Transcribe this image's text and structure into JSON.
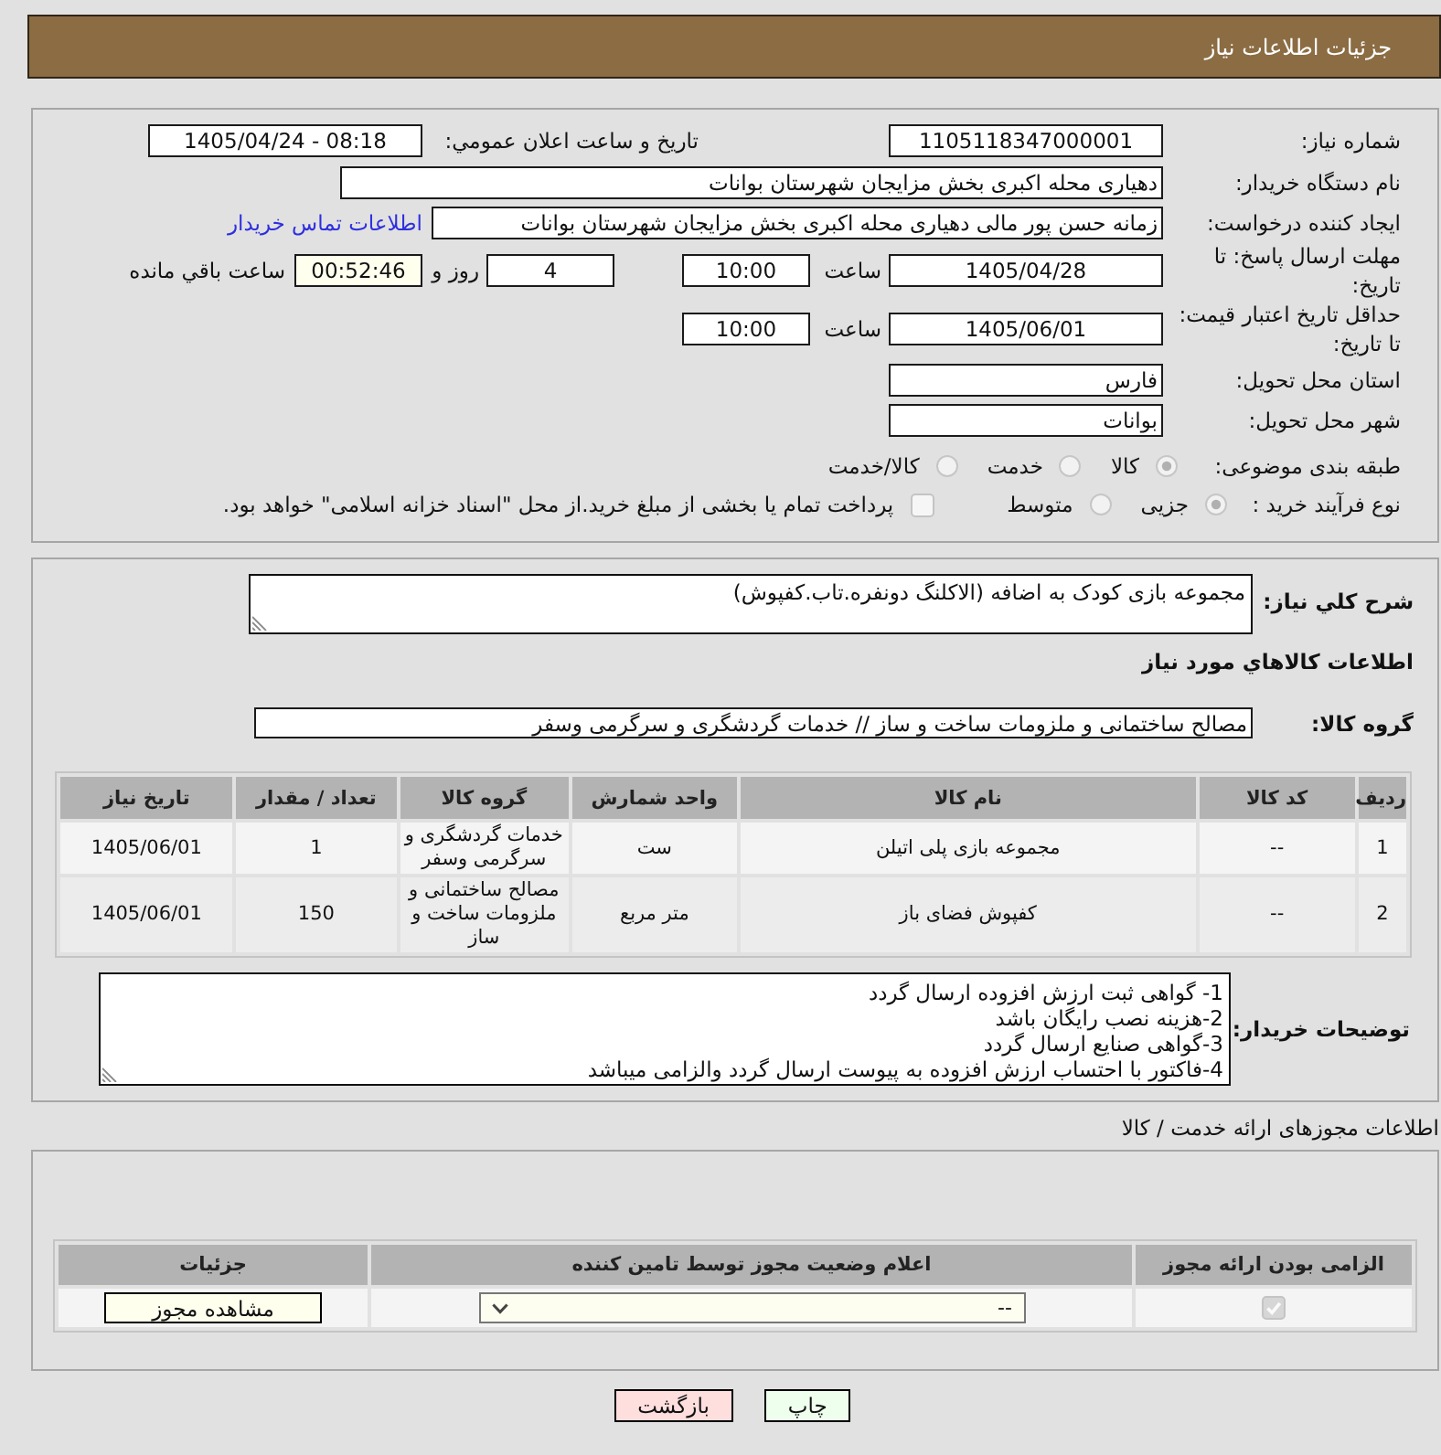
{
  "header": {
    "title": "جزئیات اطلاعات نیاز"
  },
  "summary": {
    "need_number": {
      "label": "شماره نیاز:",
      "value": "1105118347000001"
    },
    "announcement": {
      "label": "تاریخ و ساعت اعلان عمومي:",
      "value": "1405/04/24 - 08:18"
    },
    "buyer": {
      "label": "نام دستگاه خریدار:",
      "value": "دهیاری محله اکبری بخش مزایجان شهرستان بوانات"
    },
    "requester": {
      "label": "ایجاد کننده درخواست:",
      "value": "زمانه حسن پور مالی دهیاری محله اکبری بخش مزایجان شهرستان بوانات",
      "contact_link": "اطلاعات تماس خریدار"
    },
    "reply_deadline": {
      "label": "مهلت ارسال پاسخ: تا تاریخ:",
      "date": "1405/04/28",
      "time_label": "ساعت",
      "time": "10:00",
      "days": "4",
      "days_label": "روز و",
      "remaining": "00:52:46",
      "remaining_label": "ساعت باقي مانده"
    },
    "price_validity": {
      "label": "حداقل تاریخ اعتبار قیمت: تا تاریخ:",
      "date": "1405/06/01",
      "time_label": "ساعت",
      "time": "10:00"
    },
    "province": {
      "label": "استان محل تحویل:",
      "value": "فارس"
    },
    "city": {
      "label": "شهر محل تحویل:",
      "value": "بوانات"
    },
    "category": {
      "label": "طبقه بندی موضوعی:",
      "options": [
        {
          "label": "کالا",
          "selected": true
        },
        {
          "label": "خدمت",
          "selected": false
        },
        {
          "label": "کالا/خدمت",
          "selected": false
        }
      ]
    },
    "purchase_process": {
      "label": "نوع فرآیند خرید :",
      "options": [
        {
          "label": "جزیی",
          "selected": true
        },
        {
          "label": "متوسط",
          "selected": false
        }
      ],
      "treasury_payment": {
        "label": "پرداخت تمام یا بخشی از مبلغ خرید.از محل \"اسناد خزانه اسلامی\" خواهد بود.",
        "checked": false
      }
    }
  },
  "items": {
    "description_label": "شرح کلي نیاز:",
    "description": "مجموعه بازی کودک به اضافه (الاکلنگ دونفره.تاب.کفپوش)",
    "section_title": "اطلاعات کالاهاي مورد نیاز",
    "group_label": "گروه کالا:",
    "group_value": "مصالح ساختمانی و ملزومات ساخت و ساز // خدمات گردشگری و سرگرمی وسفر",
    "table": {
      "columns": [
        "ردیف",
        "کد کالا",
        "نام کالا",
        "واحد شمارش",
        "گروه کالا",
        "تعداد / مقدار",
        "تاریخ نیاز"
      ],
      "rows": [
        [
          "1",
          "--",
          "مجموعه بازی پلی اتیلن",
          "ست",
          "خدمات گردشگری و سرگرمی وسفر",
          "1",
          "1405/06/01"
        ],
        [
          "2",
          "--",
          "کفپوش فضای باز",
          "متر مربع",
          "مصالح ساختمانی و ملزومات ساخت و ساز",
          "150",
          "1405/06/01"
        ]
      ]
    },
    "notes_label": "توضیحات خریدار:",
    "notes": [
      "1- گواهی ثبت ارزش افزوده ارسال گردد",
      "2-هزینه نصب رایگان باشد",
      "3-گواهی صنایع ارسال گردد",
      "4-فاکتور با احتساب ارزش افزوده به پیوست ارسال گردد والزامی میباشد"
    ]
  },
  "permits": {
    "title": "اطلاعات مجوزهای ارائه خدمت / کالا",
    "table": {
      "columns": [
        "الزامی بودن ارائه مجوز",
        "اعلام وضعیت مجوز توسط تامین کننده",
        "جزئیات"
      ],
      "rows": [
        {
          "required": true,
          "status": "--",
          "details_button": "مشاهده مجوز"
        }
      ]
    }
  },
  "actions": [
    {
      "kind": "print",
      "label": "چاپ"
    },
    {
      "kind": "back",
      "label": "بازگشت"
    }
  ]
}
